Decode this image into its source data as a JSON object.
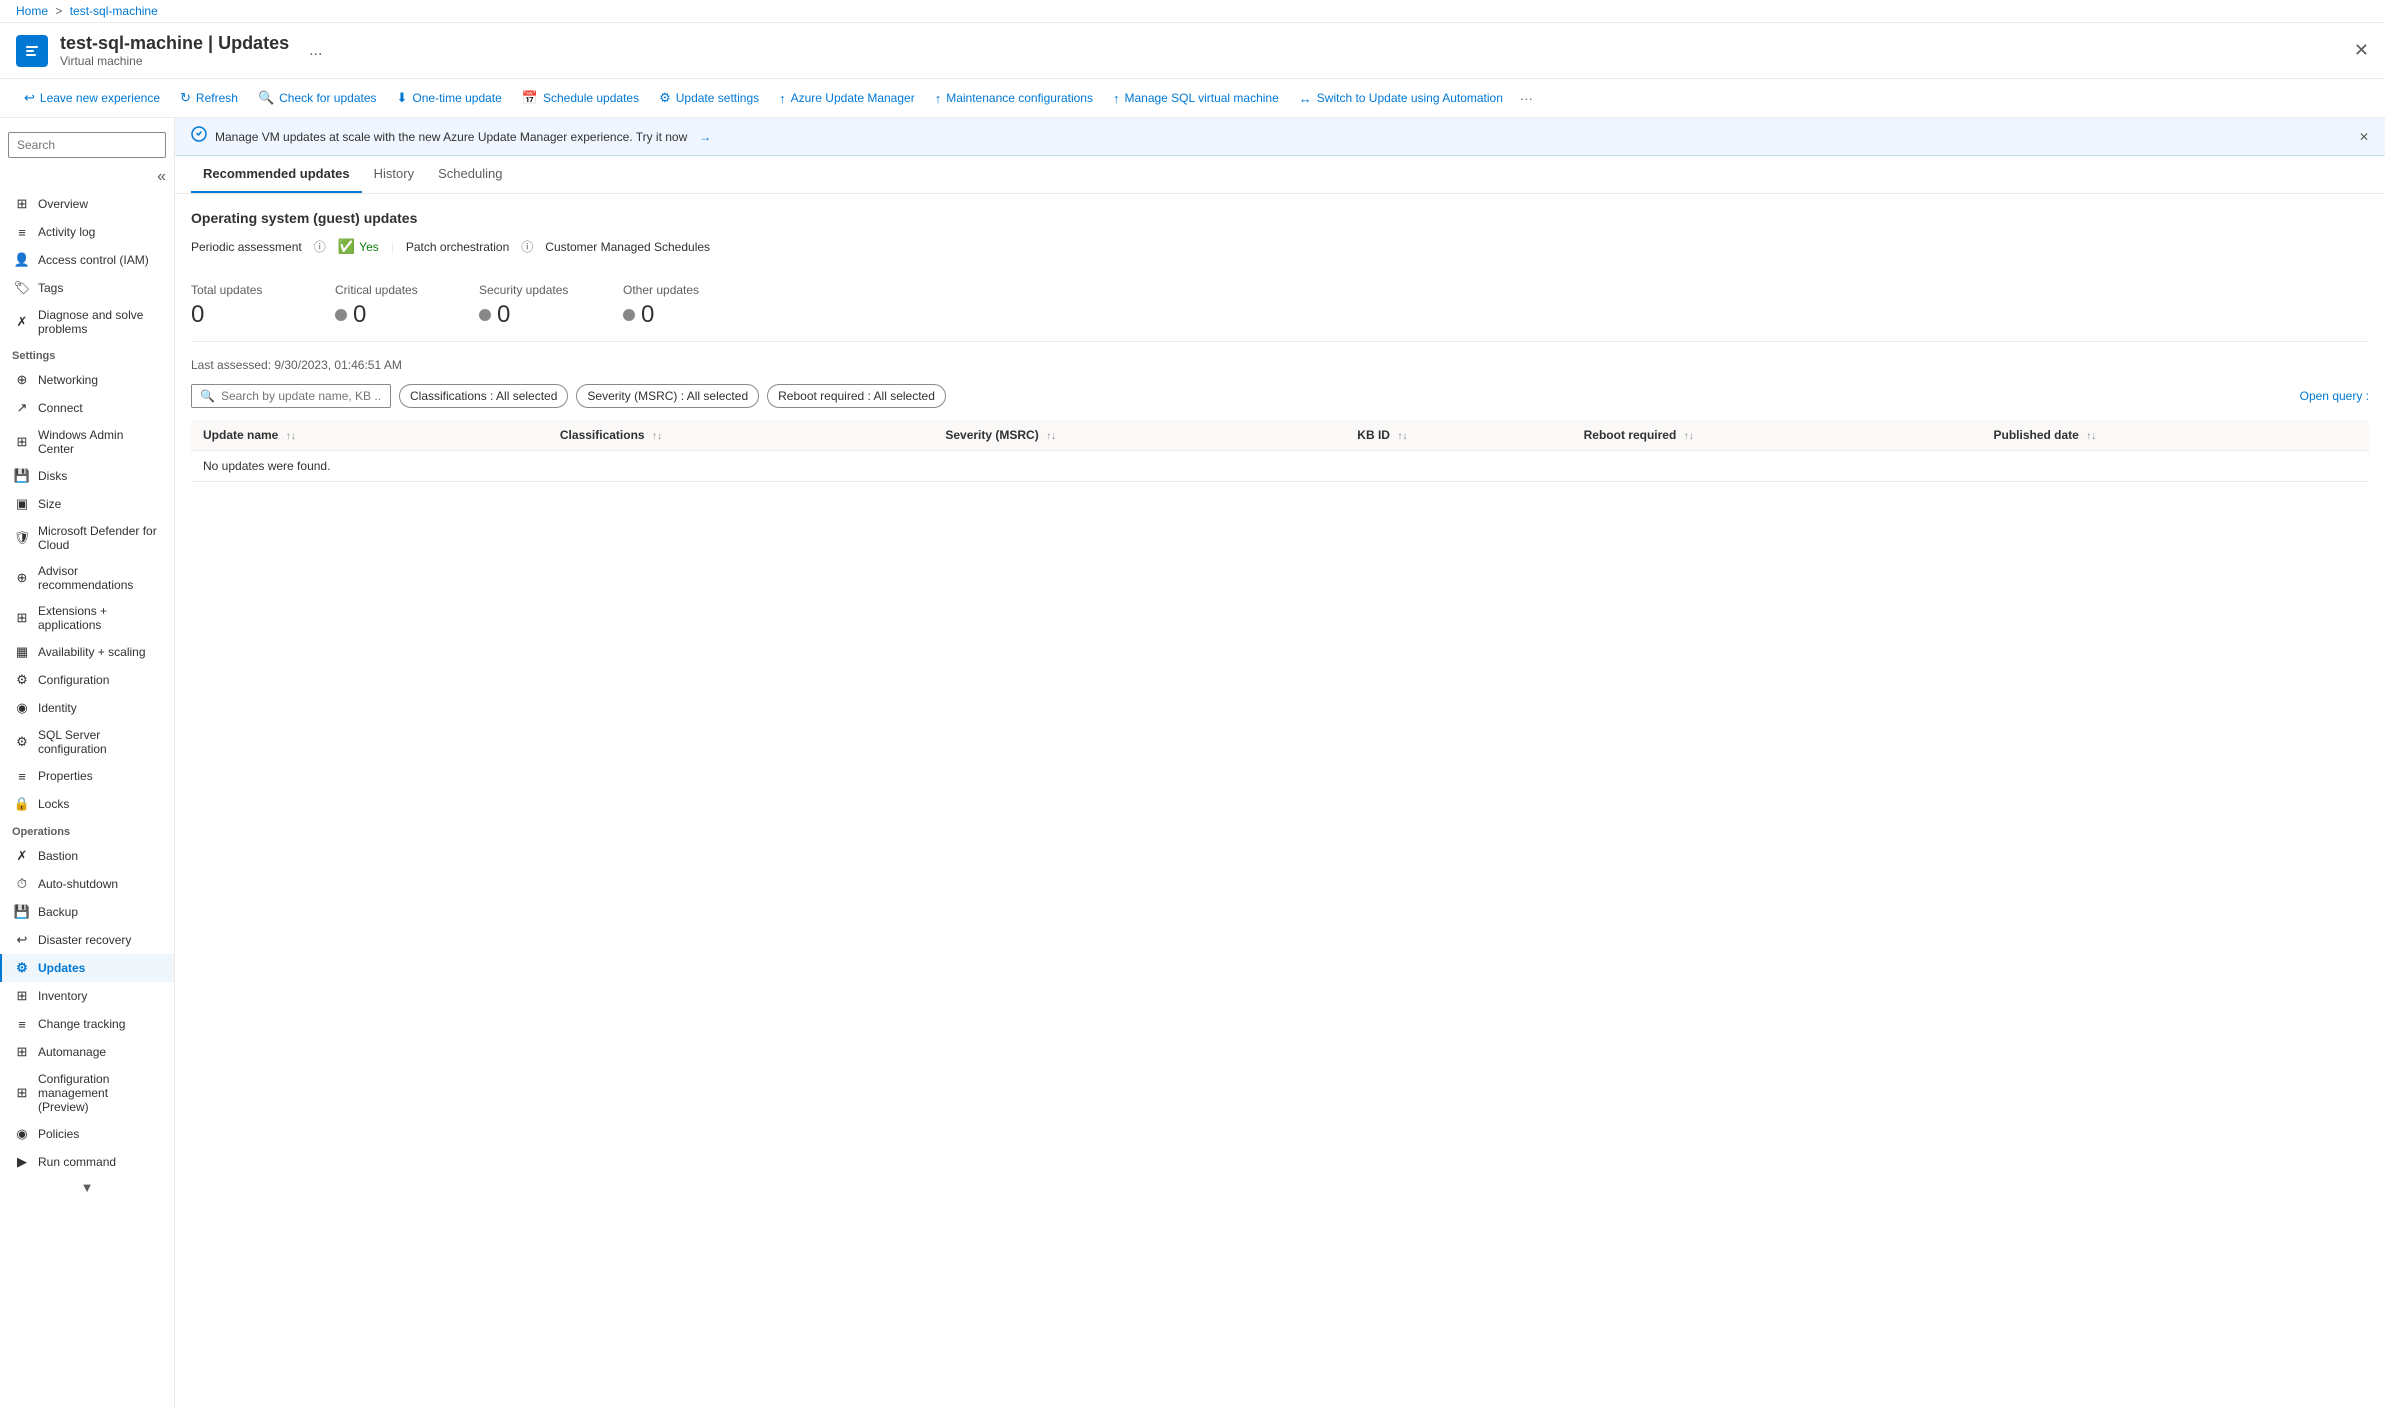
{
  "breadcrumb": {
    "home": "Home",
    "separator": ">",
    "resource": "test-sql-machine"
  },
  "header": {
    "title": "test-sql-machine | Updates",
    "subtitle": "Virtual machine",
    "more_label": "...",
    "close_label": "✕"
  },
  "toolbar": {
    "buttons": [
      {
        "id": "leave-new-experience",
        "icon": "↩",
        "label": "Leave new experience"
      },
      {
        "id": "refresh",
        "icon": "↻",
        "label": "Refresh"
      },
      {
        "id": "check-updates",
        "icon": "🔍",
        "label": "Check for updates"
      },
      {
        "id": "one-time-update",
        "icon": "⬇",
        "label": "One-time update"
      },
      {
        "id": "schedule-updates",
        "icon": "📅",
        "label": "Schedule updates"
      },
      {
        "id": "update-settings",
        "icon": "⚙",
        "label": "Update settings"
      },
      {
        "id": "azure-update-manager",
        "icon": "↑",
        "label": "Azure Update Manager"
      },
      {
        "id": "maintenance-configurations",
        "icon": "↑",
        "label": "Maintenance configurations"
      },
      {
        "id": "manage-sql",
        "icon": "↑",
        "label": "Manage SQL virtual machine"
      },
      {
        "id": "switch-to-automation",
        "icon": "↔",
        "label": "Switch to Update using Automation"
      },
      {
        "id": "more",
        "icon": "···",
        "label": ""
      }
    ]
  },
  "banner": {
    "icon": "✓",
    "text": "Manage VM updates at scale with the new Azure Update Manager experience. Try it now",
    "link_text": "→",
    "close_label": "✕"
  },
  "sidebar": {
    "search_placeholder": "Search",
    "collapse_icon": "«",
    "items": [
      {
        "id": "overview",
        "icon": "⊞",
        "label": "Overview",
        "active": false
      },
      {
        "id": "activity-log",
        "icon": "≡",
        "label": "Activity log",
        "active": false
      },
      {
        "id": "access-control",
        "icon": "👤",
        "label": "Access control (IAM)",
        "active": false
      },
      {
        "id": "tags",
        "icon": "🏷",
        "label": "Tags",
        "active": false
      },
      {
        "id": "diagnose",
        "icon": "✗",
        "label": "Diagnose and solve problems",
        "active": false
      }
    ],
    "settings_section": "Settings",
    "settings_items": [
      {
        "id": "networking",
        "icon": "⊕",
        "label": "Networking",
        "active": false
      },
      {
        "id": "connect",
        "icon": "↗",
        "label": "Connect",
        "active": false
      },
      {
        "id": "windows-admin",
        "icon": "⊞",
        "label": "Windows Admin Center",
        "active": false
      },
      {
        "id": "disks",
        "icon": "💾",
        "label": "Disks",
        "active": false
      },
      {
        "id": "size",
        "icon": "▣",
        "label": "Size",
        "active": false
      },
      {
        "id": "defender",
        "icon": "🛡",
        "label": "Microsoft Defender for Cloud",
        "active": false
      },
      {
        "id": "advisor",
        "icon": "⊕",
        "label": "Advisor recommendations",
        "active": false
      },
      {
        "id": "extensions",
        "icon": "⊞",
        "label": "Extensions + applications",
        "active": false
      },
      {
        "id": "availability",
        "icon": "▦",
        "label": "Availability + scaling",
        "active": false
      },
      {
        "id": "configuration",
        "icon": "⚙",
        "label": "Configuration",
        "active": false
      },
      {
        "id": "identity",
        "icon": "◉",
        "label": "Identity",
        "active": false
      },
      {
        "id": "sql-server-config",
        "icon": "⚙",
        "label": "SQL Server configuration",
        "active": false
      },
      {
        "id": "properties",
        "icon": "≡",
        "label": "Properties",
        "active": false
      },
      {
        "id": "locks",
        "icon": "🔒",
        "label": "Locks",
        "active": false
      }
    ],
    "operations_section": "Operations",
    "operations_items": [
      {
        "id": "bastion",
        "icon": "✗",
        "label": "Bastion",
        "active": false
      },
      {
        "id": "auto-shutdown",
        "icon": "⏱",
        "label": "Auto-shutdown",
        "active": false
      },
      {
        "id": "backup",
        "icon": "💾",
        "label": "Backup",
        "active": false
      },
      {
        "id": "disaster-recovery",
        "icon": "↩",
        "label": "Disaster recovery",
        "active": false
      },
      {
        "id": "updates",
        "icon": "⚙",
        "label": "Updates",
        "active": true
      },
      {
        "id": "inventory",
        "icon": "⊞",
        "label": "Inventory",
        "active": false
      },
      {
        "id": "change-tracking",
        "icon": "≡",
        "label": "Change tracking",
        "active": false
      },
      {
        "id": "automanage",
        "icon": "⊞",
        "label": "Automanage",
        "active": false
      },
      {
        "id": "configuration-management",
        "icon": "⊞",
        "label": "Configuration management (Preview)",
        "active": false
      },
      {
        "id": "policies",
        "icon": "◉",
        "label": "Policies",
        "active": false
      },
      {
        "id": "run-command",
        "icon": "▶",
        "label": "Run command",
        "active": false
      }
    ],
    "scroll_down_icon": "▼"
  },
  "tabs": [
    {
      "id": "recommended-updates",
      "label": "Recommended updates",
      "active": true
    },
    {
      "id": "history",
      "label": "History",
      "active": false
    },
    {
      "id": "scheduling",
      "label": "Scheduling",
      "active": false
    }
  ],
  "content": {
    "section_title": "Operating system (guest) updates",
    "periodic_assessment_label": "Periodic assessment",
    "periodic_assessment_info": "ⓘ",
    "periodic_assessment_value": "Yes",
    "separator": "|",
    "patch_orchestration_label": "Patch orchestration",
    "patch_orchestration_info": "ⓘ",
    "customer_managed_label": "Customer Managed Schedules",
    "stats": [
      {
        "id": "total",
        "label": "Total updates",
        "value": "0",
        "dot": false
      },
      {
        "id": "critical",
        "label": "Critical updates",
        "value": "0",
        "dot": true
      },
      {
        "id": "security",
        "label": "Security updates",
        "value": "0",
        "dot": true
      },
      {
        "id": "other",
        "label": "Other updates",
        "value": "0",
        "dot": true
      }
    ],
    "last_assessed": "Last assessed: 9/30/2023, 01:46:51 AM",
    "search_placeholder": "Search by update name, KB ...",
    "filters": [
      {
        "id": "classifications",
        "label": "Classifications : All selected"
      },
      {
        "id": "severity",
        "label": "Severity (MSRC) : All selected"
      },
      {
        "id": "reboot-required",
        "label": "Reboot required : All selected"
      }
    ],
    "open_query_label": "Open query :",
    "table": {
      "columns": [
        {
          "id": "update-name",
          "label": "Update name"
        },
        {
          "id": "classifications",
          "label": "Classifications"
        },
        {
          "id": "severity-msrc",
          "label": "Severity (MSRC)"
        },
        {
          "id": "kb-id",
          "label": "KB ID"
        },
        {
          "id": "reboot-required",
          "label": "Reboot required"
        },
        {
          "id": "published-date",
          "label": "Published date"
        }
      ],
      "no_data_message": "No updates were found."
    }
  }
}
